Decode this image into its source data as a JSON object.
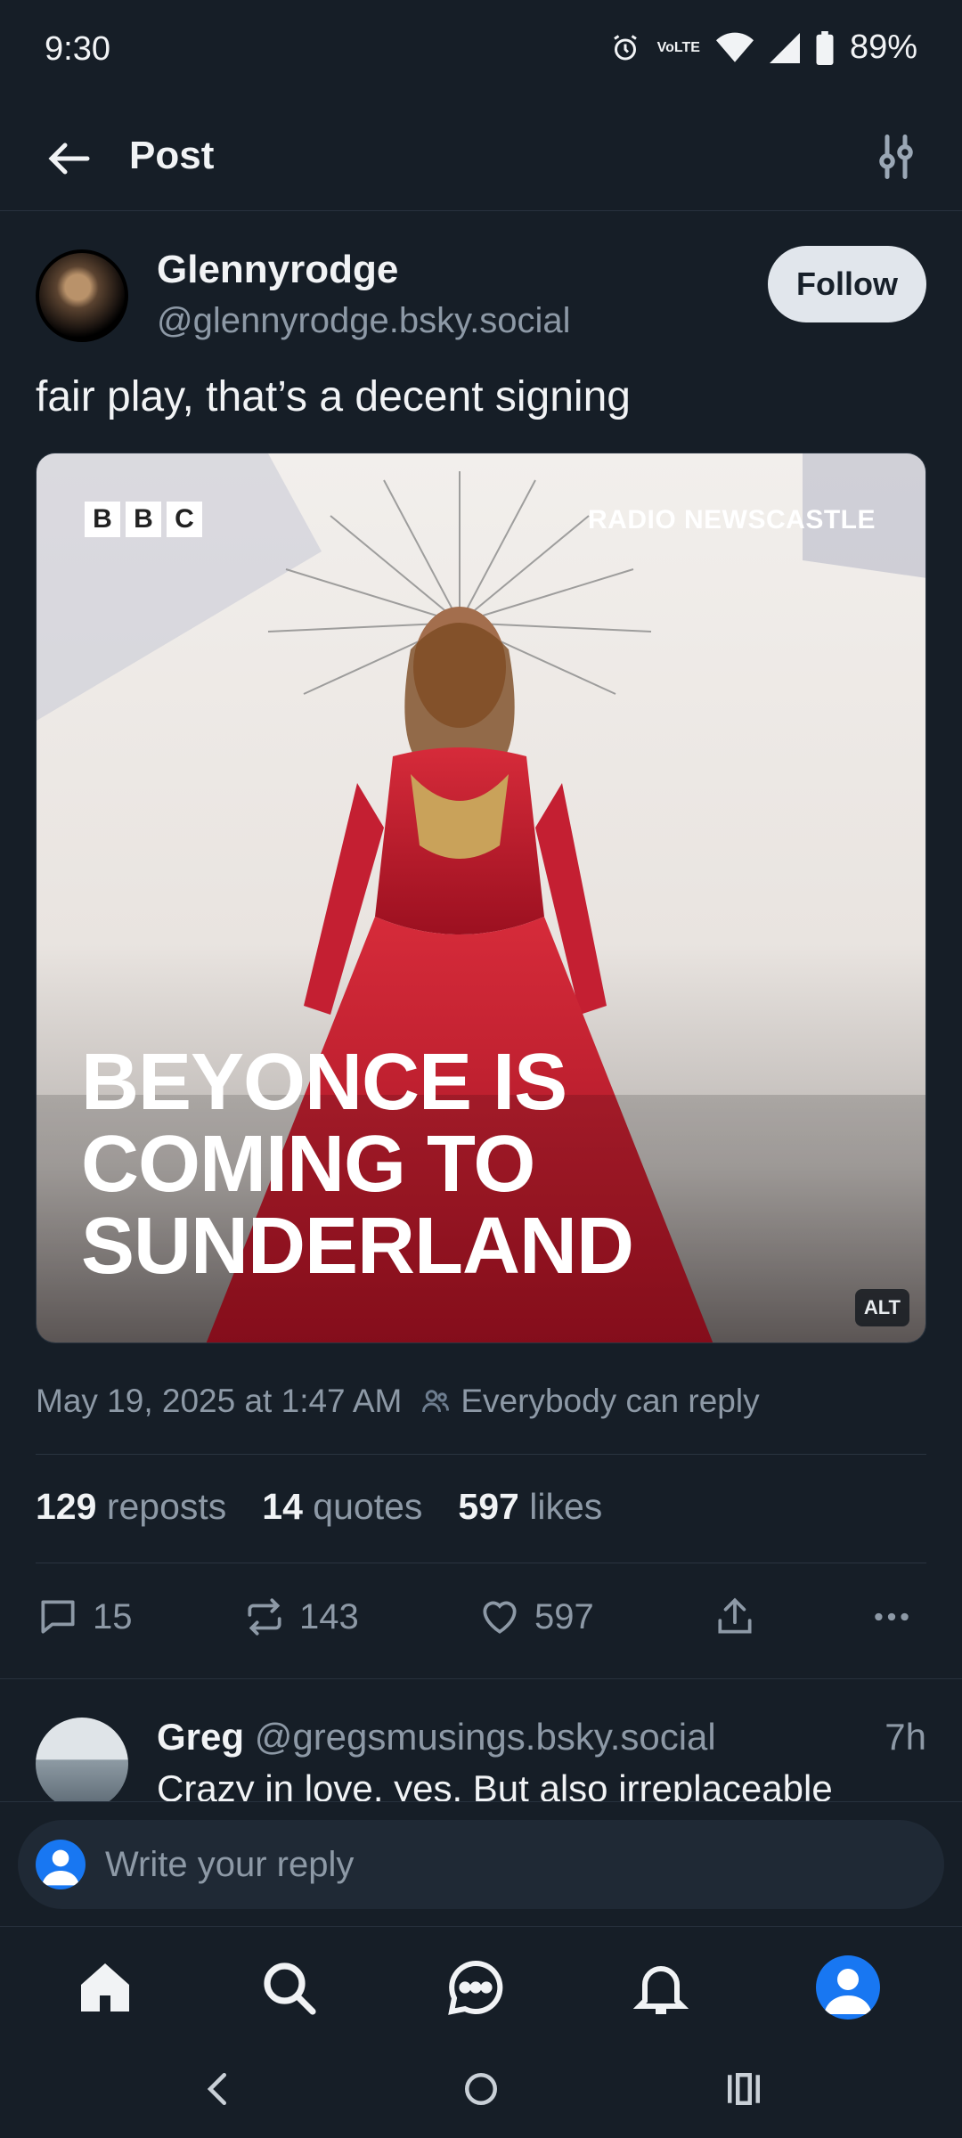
{
  "status_bar": {
    "time": "9:30",
    "volte": "VoLTE",
    "battery": "89%"
  },
  "header": {
    "title": "Post"
  },
  "post": {
    "author_name": "Glennyrodge",
    "author_handle": "@glennyrodge.bsky.social",
    "follow_label": "Follow",
    "text": "fair play, that’s a decent signing",
    "image": {
      "logo": "BBC",
      "brand": "RADIO NEWSCASTLE",
      "headline_lines": [
        "BEYONCE IS",
        "COMING TO",
        "SUNDERLAND"
      ],
      "alt_badge": "ALT"
    },
    "timestamp": "May 19, 2025 at 1:47 AM",
    "reply_permission": "Everybody can reply",
    "stats": {
      "reposts_count": "129",
      "reposts_label": "reposts",
      "quotes_count": "14",
      "quotes_label": "quotes",
      "likes_count": "597",
      "likes_label": "likes"
    },
    "actions": {
      "replies": "15",
      "reposts": "143",
      "likes": "597"
    }
  },
  "reply": {
    "name": "Greg",
    "handle": "@gregsmusings.bsky.social",
    "time": "7h",
    "text": "Crazy in love, yes. But also irreplaceable"
  },
  "compose": {
    "placeholder": "Write your reply"
  },
  "colors": {
    "background": "#161e27",
    "accent": "#1877f2",
    "muted": "#8d99a6"
  },
  "icons": [
    "back-arrow-icon",
    "filter-icon",
    "users-icon",
    "comment-icon",
    "repost-icon",
    "heart-icon",
    "share-icon",
    "more-icon",
    "home-icon",
    "search-icon",
    "chat-icon",
    "bell-icon",
    "profile-icon"
  ]
}
